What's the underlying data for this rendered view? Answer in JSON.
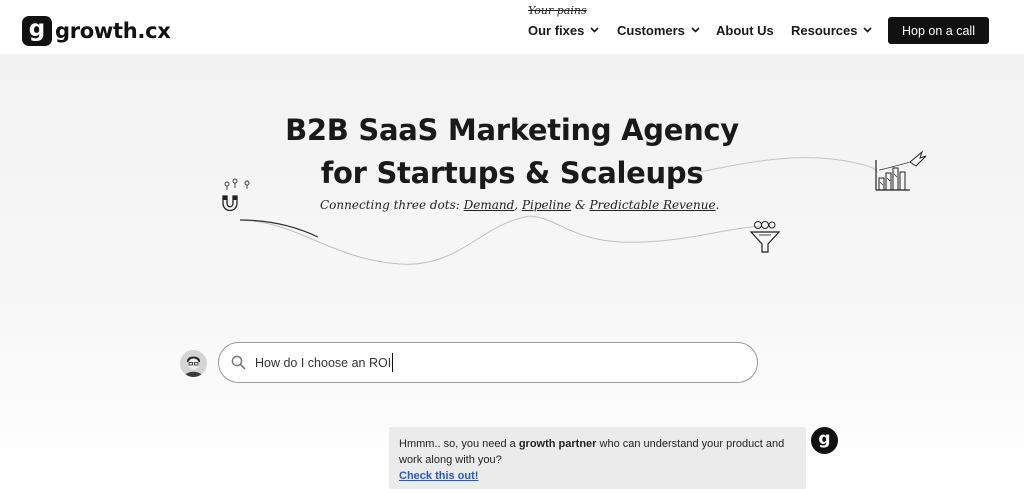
{
  "brand": {
    "name": "growth.cx",
    "mark": "g"
  },
  "nav": {
    "annotation": "Your pains",
    "items": [
      {
        "label": "Our fixes",
        "has_dropdown": true
      },
      {
        "label": "Customers",
        "has_dropdown": true
      },
      {
        "label": "About Us",
        "has_dropdown": false
      },
      {
        "label": "Resources",
        "has_dropdown": true
      }
    ],
    "cta_label": "Hop on a call"
  },
  "hero": {
    "title_line1": "B2B SaaS Marketing Agency",
    "title_line2": "for Startups & Scaleups",
    "tagline_prefix": "Connecting three dots: ",
    "tagline_dot1": "Demand",
    "tagline_sep1": ", ",
    "tagline_dot2": "Pipeline",
    "tagline_sep2": " & ",
    "tagline_dot3": "Predictable Revenue",
    "tagline_suffix": "."
  },
  "chat": {
    "query_value": "How do I choose an ROI",
    "reply_prefix": "Hmmm.. so, you need a ",
    "reply_bold": "growth partner",
    "reply_suffix": " who can understand your product and work along with you?",
    "reply_link": "Check this out!",
    "bot_mark": "g"
  },
  "icons": {
    "search": "search-icon",
    "chevron": "chevron-down-icon",
    "magnet": "magnet-icon",
    "funnel": "funnel-icon",
    "growth_chart": "bar-chart-rocket-icon"
  },
  "colors": {
    "brand_black": "#111111",
    "link_blue": "#1f5bd6",
    "reply_bg": "#ebebeb"
  }
}
